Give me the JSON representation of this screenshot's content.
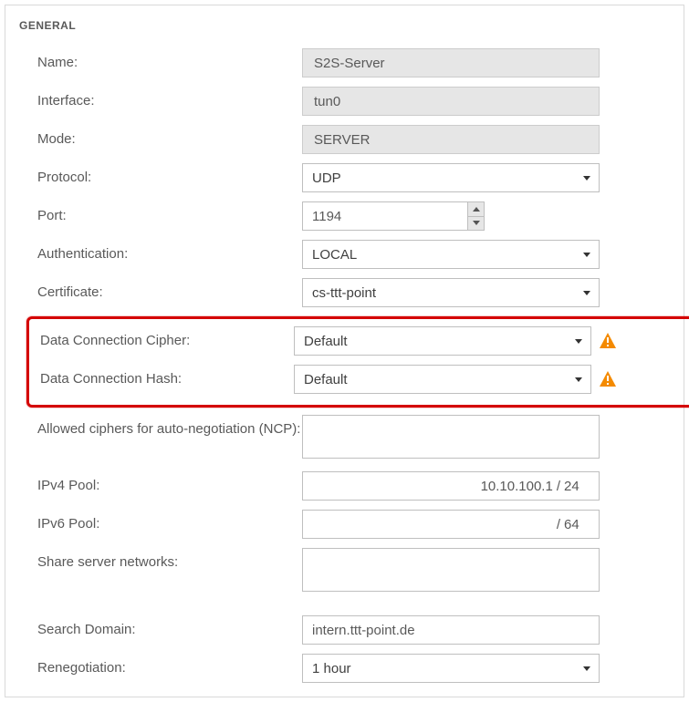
{
  "section_title": "GENERAL",
  "fields": {
    "name": {
      "label": "Name:",
      "value": "S2S-Server"
    },
    "interface": {
      "label": "Interface:",
      "value": "tun0"
    },
    "mode": {
      "label": "Mode:",
      "value": "SERVER"
    },
    "protocol": {
      "label": "Protocol:",
      "value": "UDP"
    },
    "port": {
      "label": "Port:",
      "value": "1194"
    },
    "authentication": {
      "label": "Authentication:",
      "value": "LOCAL"
    },
    "certificate": {
      "label": "Certificate:",
      "value": "cs-ttt-point"
    },
    "cipher": {
      "label": "Data Connection Cipher:",
      "value": "Default"
    },
    "hash": {
      "label": "Data Connection Hash:",
      "value": "Default"
    },
    "ncp": {
      "label": "Allowed ciphers for auto-negotiation (NCP):",
      "value": ""
    },
    "ipv4pool": {
      "label": "IPv4 Pool:",
      "addr": "10.10.100.1",
      "mask": "24"
    },
    "ipv6pool": {
      "label": "IPv6 Pool:",
      "addr": "",
      "prefix": "64"
    },
    "share": {
      "label": "Share server networks:",
      "value": ""
    },
    "search_domain": {
      "label": "Search Domain:",
      "value": "intern.ttt-point.de"
    },
    "renegotiation": {
      "label": "Renegotiation:",
      "value": "1 hour"
    }
  }
}
